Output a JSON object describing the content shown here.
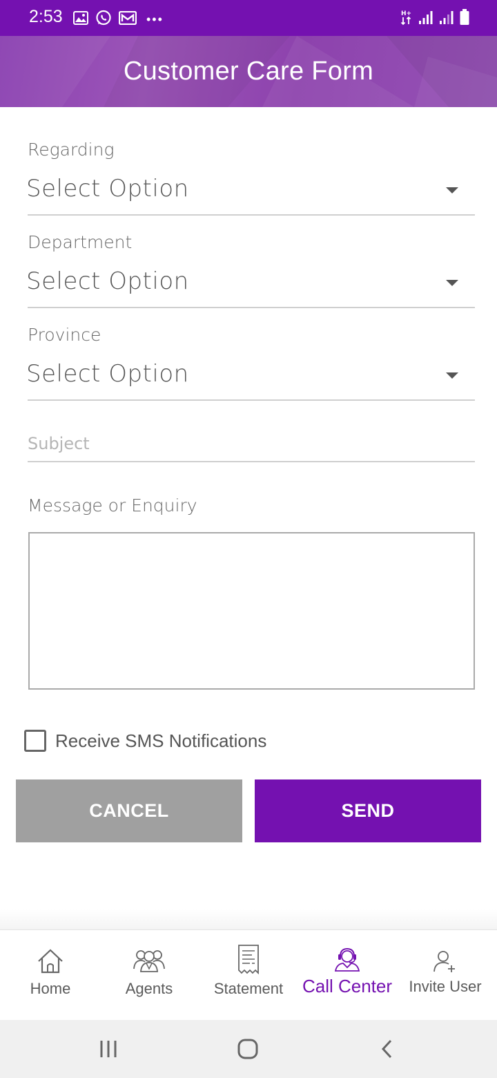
{
  "status_bar": {
    "time": "2:53",
    "icons_left": [
      "image-icon",
      "whatsapp-icon",
      "mail-icon",
      "more-dots-icon"
    ],
    "icons_right": [
      "data-arrows-icon",
      "signal-icon",
      "signal-icon",
      "battery-icon"
    ],
    "network_label": "H+",
    "more": "•••"
  },
  "header": {
    "title": "Customer Care Form"
  },
  "form": {
    "regarding": {
      "label": "Regarding",
      "value": "Select Option"
    },
    "department": {
      "label": "Department",
      "value": "Select Option"
    },
    "province": {
      "label": "Province",
      "value": "Select Option"
    },
    "subject": {
      "placeholder": "Subject"
    },
    "message": {
      "label": "Message or Enquiry",
      "value": ""
    },
    "sms": {
      "label": "Receive SMS Notifications",
      "checked": false
    },
    "cancel_label": "CANCEL",
    "send_label": "SEND"
  },
  "bottom_nav": {
    "items": [
      {
        "label": "Home",
        "icon": "home-icon"
      },
      {
        "label": "Agents",
        "icon": "agents-icon"
      },
      {
        "label": "Statement",
        "icon": "statement-icon"
      },
      {
        "label": "Call Center",
        "icon": "call-center-icon",
        "active": true
      },
      {
        "label": "Invite User",
        "icon": "invite-user-icon"
      }
    ]
  },
  "colors": {
    "accent": "#7411b0",
    "cancel": "#a0a0a0"
  }
}
